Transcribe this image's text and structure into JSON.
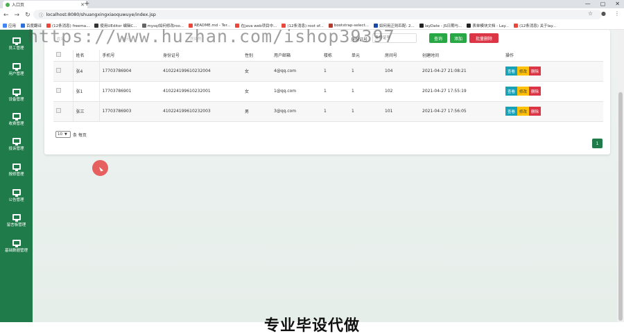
{
  "browser": {
    "tab_title": "入口页",
    "url": "localhost:8080/shuangxingxiaoquwuye/index.jsp",
    "bookmarks": [
      {
        "label": "应用",
        "color": "#4285f4"
      },
      {
        "label": "百度翻译",
        "color": "#2a6fdb"
      },
      {
        "label": "(12条消息) freema...",
        "color": "#e8473a"
      },
      {
        "label": "使用UEditor 编辑C...",
        "color": "#333333"
      },
      {
        "label": "mysql如何修改roo...",
        "color": "#666666"
      },
      {
        "label": "README.md - Ter...",
        "color": "#e8473a"
      },
      {
        "label": "在java web项目中...",
        "color": "#e8473a"
      },
      {
        "label": "(12条消息) root of...",
        "color": "#e8473a"
      },
      {
        "label": "bootstrap-select...",
        "color": "#b23b2e"
      },
      {
        "label": "如何用正则匹配: 2...",
        "color": "#1a47a8"
      },
      {
        "label": "layDate - JS日期与...",
        "color": "#222222"
      },
      {
        "label": "表单模块文档 - Lay...",
        "color": "#222222"
      },
      {
        "label": "(12条消息) 关于lay...",
        "color": "#e8473a"
      }
    ]
  },
  "sidebar": {
    "items": [
      {
        "label": "员工管理"
      },
      {
        "label": "用户管理"
      },
      {
        "label": "设备管理"
      },
      {
        "label": "收费管理"
      },
      {
        "label": "投诉管理"
      },
      {
        "label": "报修管理"
      },
      {
        "label": "公告管理"
      },
      {
        "label": "留言板管理"
      },
      {
        "label": "基础数据管理"
      }
    ]
  },
  "filter": {
    "faint_1": "姓名",
    "faint_2": "单元",
    "faint_3": "房间号",
    "id_label": "身份证号",
    "id_placeholder": "身份证号",
    "query_button": "查询",
    "add_button": "添加",
    "batch_delete_button": "批量删除"
  },
  "table": {
    "headers": [
      "",
      "姓名",
      "手机号",
      "身份证号",
      "性别",
      "用户邮箱",
      "楼栋",
      "单元",
      "房间号",
      "创建时间",
      "操作"
    ],
    "rows": [
      {
        "name": "张4",
        "phone": "17703786904",
        "id": "410224199610232004",
        "gender": "女",
        "email": "4@qq.com",
        "building": "1",
        "unit": "1",
        "room": "104",
        "created": "2021-04-27 21:08:21"
      },
      {
        "name": "张1",
        "phone": "17703786901",
        "id": "410224199610232001",
        "gender": "女",
        "email": "1@qq.com",
        "building": "1",
        "unit": "1",
        "room": "102",
        "created": "2021-04-27 17:55:19"
      },
      {
        "name": "张三",
        "phone": "17703786903",
        "id": "410224199610232003",
        "gender": "男",
        "email": "3@qq.com",
        "building": "1",
        "unit": "1",
        "room": "101",
        "created": "2021-04-27 17:56:05"
      }
    ],
    "actions": {
      "view": "查看",
      "edit": "修改",
      "delete": "删除"
    }
  },
  "pagination": {
    "page_size": "10",
    "per_page_label": "条 每页",
    "current_page": "1"
  },
  "overlay": {
    "watermark": "https://www.huzhan.com/ishop39397",
    "footer_text": "专业毕设代做"
  }
}
